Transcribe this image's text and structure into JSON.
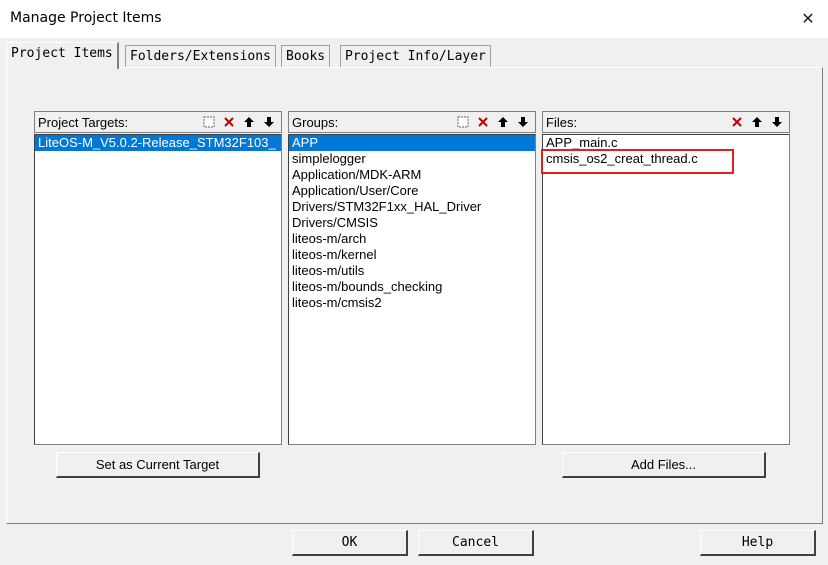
{
  "window": {
    "title": "Manage Project Items"
  },
  "tabs": [
    {
      "label": "Project Items"
    },
    {
      "label": "Folders/Extensions"
    },
    {
      "label": "Books"
    },
    {
      "label": "Project Info/Layer"
    }
  ],
  "targets": {
    "label": "Project Targets:",
    "items": [
      "LiteOS-M_V5.0.2-Release_STM32F103_"
    ],
    "selected": 0,
    "set_current_label": "Set as Current Target"
  },
  "groups": {
    "label": "Groups:",
    "items": [
      "APP",
      "simplelogger",
      "Application/MDK-ARM",
      "Application/User/Core",
      "Drivers/STM32F1xx_HAL_Driver",
      "Drivers/CMSIS",
      "liteos-m/arch",
      "liteos-m/kernel",
      "liteos-m/utils",
      "liteos-m/bounds_checking",
      "liteos-m/cmsis2"
    ],
    "selected": 0
  },
  "files": {
    "label": "Files:",
    "items": [
      "APP_main.c",
      "cmsis_os2_creat_thread.c"
    ],
    "add_files_label": "Add Files..."
  },
  "footer": {
    "ok": "OK",
    "cancel": "Cancel",
    "help": "Help"
  },
  "icons": {
    "new": "new-item-icon",
    "delete": "delete-icon",
    "up": "move-up-icon",
    "down": "move-down-icon",
    "close": "close-icon"
  },
  "colors": {
    "selection": "#0078d7",
    "highlight": "#e02020"
  }
}
